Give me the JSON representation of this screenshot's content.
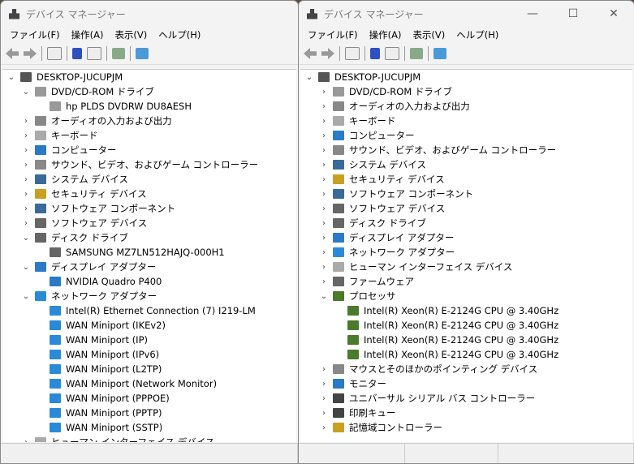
{
  "window": {
    "title": "デバイス マネージャー",
    "minimize": "—",
    "maximize": "☐",
    "close": "✕"
  },
  "menu": [
    "ファイル(F)",
    "操作(A)",
    "表示(V)",
    "ヘルプ(H)"
  ],
  "icon_colors": {
    "pc": "#555",
    "net": "#2a8ad8",
    "disk": "#666",
    "cpu": "#4a7a2a",
    "audio": "#888",
    "kbd": "#aaa",
    "display": "#2a7ac8",
    "sec": "#c9a020",
    "sw": "#3a6a9a",
    "usb": "#444",
    "dvd": "#999"
  },
  "left_tree": [
    {
      "level": 0,
      "state": "open",
      "icon": "pc",
      "label": "DESKTOP-JUCUPJM"
    },
    {
      "level": 1,
      "state": "open",
      "icon": "dvd",
      "label": "DVD/CD-ROM ドライブ"
    },
    {
      "level": 2,
      "state": "none",
      "icon": "dvd",
      "label": "hp PLDS DVDRW  DU8AESH"
    },
    {
      "level": 1,
      "state": "closed",
      "icon": "audio",
      "label": "オーディオの入力および出力"
    },
    {
      "level": 1,
      "state": "closed",
      "icon": "kbd",
      "label": "キーボード"
    },
    {
      "level": 1,
      "state": "closed",
      "icon": "display",
      "label": "コンピューター"
    },
    {
      "level": 1,
      "state": "closed",
      "icon": "audio",
      "label": "サウンド、ビデオ、およびゲーム コントローラー"
    },
    {
      "level": 1,
      "state": "closed",
      "icon": "sw",
      "label": "システム デバイス"
    },
    {
      "level": 1,
      "state": "closed",
      "icon": "sec",
      "label": "セキュリティ デバイス"
    },
    {
      "level": 1,
      "state": "closed",
      "icon": "sw",
      "label": "ソフトウェア コンポーネント"
    },
    {
      "level": 1,
      "state": "closed",
      "icon": "disk",
      "label": "ソフトウェア デバイス"
    },
    {
      "level": 1,
      "state": "open",
      "icon": "disk",
      "label": "ディスク ドライブ"
    },
    {
      "level": 2,
      "state": "none",
      "icon": "disk",
      "label": "SAMSUNG MZ7LN512HAJQ-000H1"
    },
    {
      "level": 1,
      "state": "open",
      "icon": "display",
      "label": "ディスプレイ アダプター"
    },
    {
      "level": 2,
      "state": "none",
      "icon": "display",
      "label": "NVIDIA Quadro P400"
    },
    {
      "level": 1,
      "state": "open",
      "icon": "net",
      "label": "ネットワーク アダプター"
    },
    {
      "level": 2,
      "state": "none",
      "icon": "net",
      "label": "Intel(R) Ethernet Connection (7) I219-LM"
    },
    {
      "level": 2,
      "state": "none",
      "icon": "net",
      "label": "WAN Miniport (IKEv2)"
    },
    {
      "level": 2,
      "state": "none",
      "icon": "net",
      "label": "WAN Miniport (IP)"
    },
    {
      "level": 2,
      "state": "none",
      "icon": "net",
      "label": "WAN Miniport (IPv6)"
    },
    {
      "level": 2,
      "state": "none",
      "icon": "net",
      "label": "WAN Miniport (L2TP)"
    },
    {
      "level": 2,
      "state": "none",
      "icon": "net",
      "label": "WAN Miniport (Network Monitor)"
    },
    {
      "level": 2,
      "state": "none",
      "icon": "net",
      "label": "WAN Miniport (PPPOE)"
    },
    {
      "level": 2,
      "state": "none",
      "icon": "net",
      "label": "WAN Miniport (PPTP)"
    },
    {
      "level": 2,
      "state": "none",
      "icon": "net",
      "label": "WAN Miniport (SSTP)"
    },
    {
      "level": 1,
      "state": "closed",
      "icon": "kbd",
      "label": "ヒューマン インターフェイス デバイス"
    }
  ],
  "right_tree": [
    {
      "level": 0,
      "state": "open",
      "icon": "pc",
      "label": "DESKTOP-JUCUPJM"
    },
    {
      "level": 1,
      "state": "closed",
      "icon": "dvd",
      "label": "DVD/CD-ROM ドライブ"
    },
    {
      "level": 1,
      "state": "closed",
      "icon": "audio",
      "label": "オーディオの入力および出力"
    },
    {
      "level": 1,
      "state": "closed",
      "icon": "kbd",
      "label": "キーボード"
    },
    {
      "level": 1,
      "state": "closed",
      "icon": "display",
      "label": "コンピューター"
    },
    {
      "level": 1,
      "state": "closed",
      "icon": "audio",
      "label": "サウンド、ビデオ、およびゲーム コントローラー"
    },
    {
      "level": 1,
      "state": "closed",
      "icon": "sw",
      "label": "システム デバイス"
    },
    {
      "level": 1,
      "state": "closed",
      "icon": "sec",
      "label": "セキュリティ デバイス"
    },
    {
      "level": 1,
      "state": "closed",
      "icon": "sw",
      "label": "ソフトウェア コンポーネント"
    },
    {
      "level": 1,
      "state": "closed",
      "icon": "disk",
      "label": "ソフトウェア デバイス"
    },
    {
      "level": 1,
      "state": "closed",
      "icon": "disk",
      "label": "ディスク ドライブ"
    },
    {
      "level": 1,
      "state": "closed",
      "icon": "display",
      "label": "ディスプレイ アダプター"
    },
    {
      "level": 1,
      "state": "closed",
      "icon": "net",
      "label": "ネットワーク アダプター"
    },
    {
      "level": 1,
      "state": "closed",
      "icon": "kbd",
      "label": "ヒューマン インターフェイス デバイス"
    },
    {
      "level": 1,
      "state": "closed",
      "icon": "disk",
      "label": "ファームウェア"
    },
    {
      "level": 1,
      "state": "open",
      "icon": "cpu",
      "label": "プロセッサ"
    },
    {
      "level": 2,
      "state": "none",
      "icon": "cpu",
      "label": "Intel(R) Xeon(R) E-2124G CPU @ 3.40GHz"
    },
    {
      "level": 2,
      "state": "none",
      "icon": "cpu",
      "label": "Intel(R) Xeon(R) E-2124G CPU @ 3.40GHz"
    },
    {
      "level": 2,
      "state": "none",
      "icon": "cpu",
      "label": "Intel(R) Xeon(R) E-2124G CPU @ 3.40GHz"
    },
    {
      "level": 2,
      "state": "none",
      "icon": "cpu",
      "label": "Intel(R) Xeon(R) E-2124G CPU @ 3.40GHz"
    },
    {
      "level": 1,
      "state": "closed",
      "icon": "audio",
      "label": "マウスとそのほかのポインティング デバイス"
    },
    {
      "level": 1,
      "state": "closed",
      "icon": "display",
      "label": "モニター"
    },
    {
      "level": 1,
      "state": "closed",
      "icon": "usb",
      "label": "ユニバーサル シリアル バス コントローラー"
    },
    {
      "level": 1,
      "state": "closed",
      "icon": "usb",
      "label": "印刷キュー"
    },
    {
      "level": 1,
      "state": "closed",
      "icon": "sec",
      "label": "記憶域コントローラー"
    }
  ]
}
